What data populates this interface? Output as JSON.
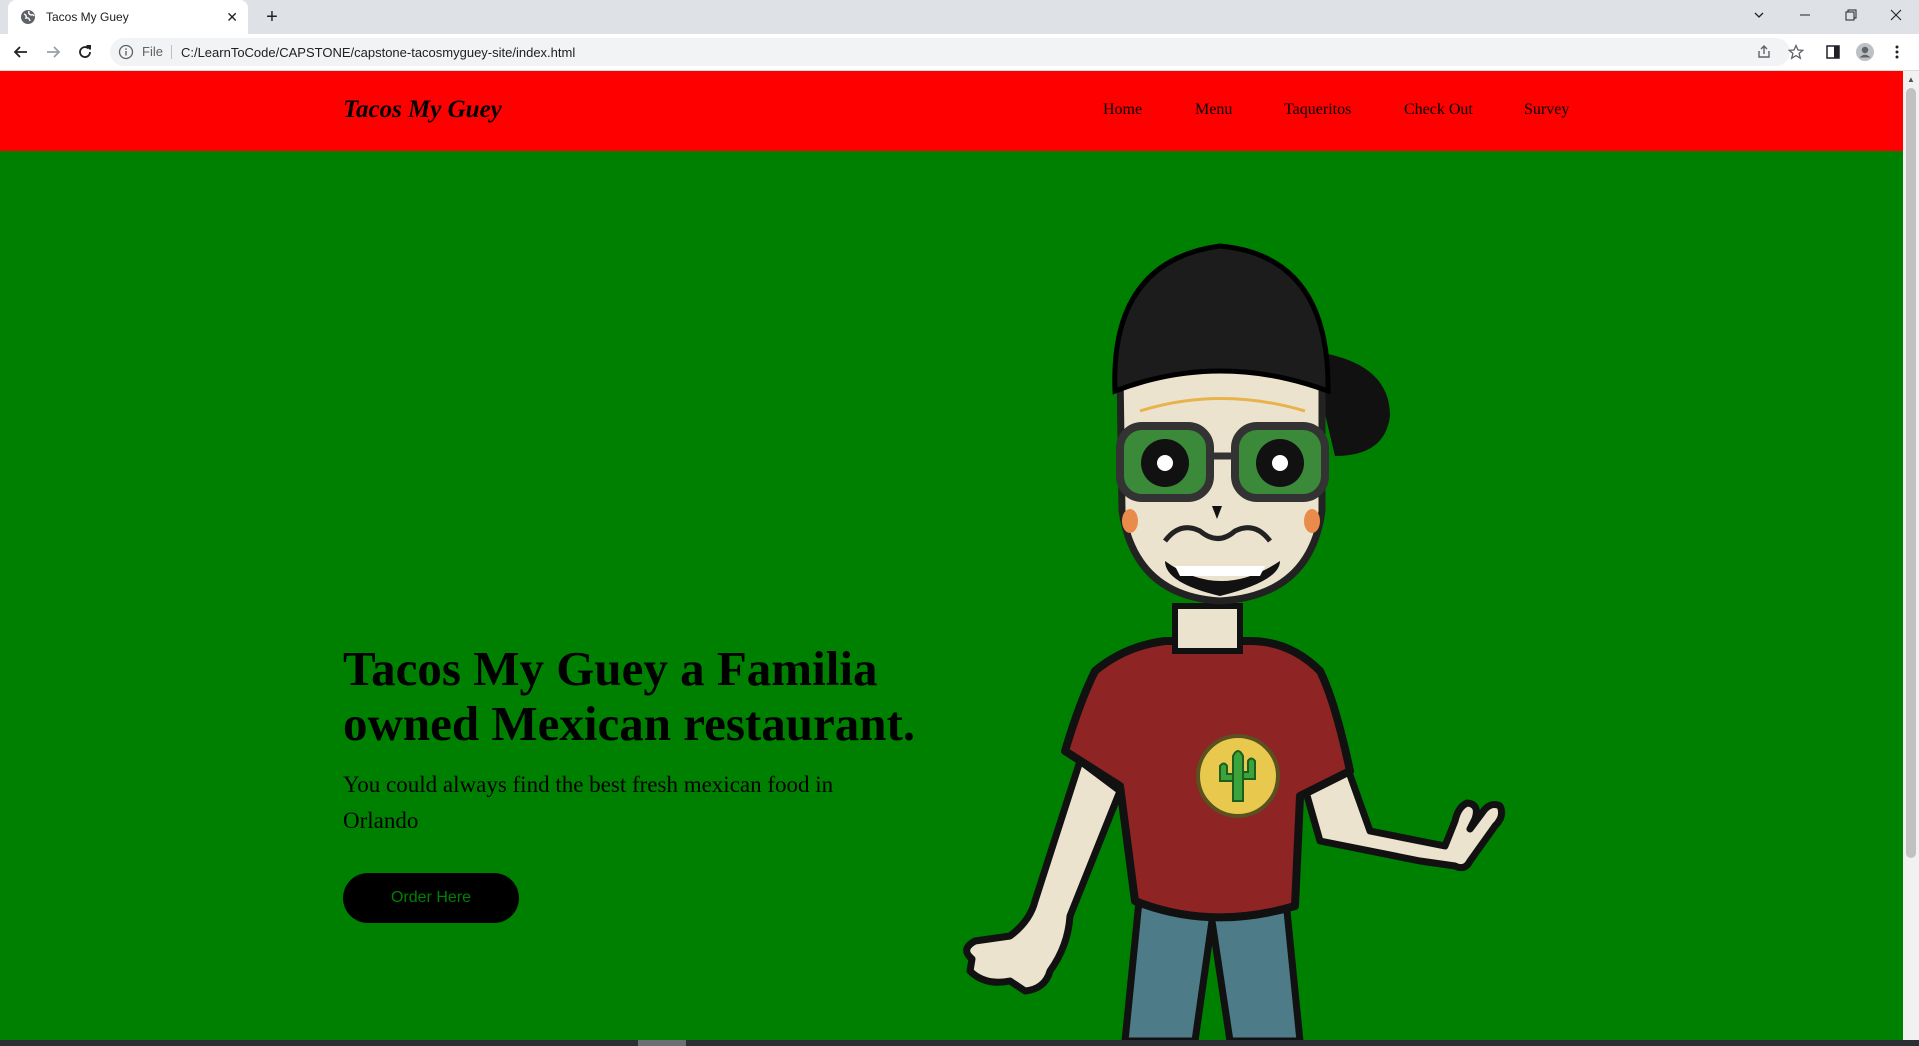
{
  "browser": {
    "tab_title": "Tacos My Guey",
    "tab_close": "✕",
    "new_tab": "+",
    "url_scheme": "File",
    "url": "C:/LearnToCode/CAPSTONE/capstone-tacosmyguey-site/index.html"
  },
  "site": {
    "brand": "Tacos My Guey",
    "nav": [
      "Home",
      "Menu",
      "Taqueritos",
      "Check Out",
      "Survey"
    ],
    "hero_title": "Tacos My Guey a Familia owned Mexican restaurant.",
    "hero_sub": "You could always find the best fresh mexican food in Orlando",
    "order_button": "Order Here"
  },
  "colors": {
    "nav_bg": "#ff0000",
    "hero_bg": "#008000",
    "button_bg": "#000000",
    "button_text": "#008000"
  }
}
